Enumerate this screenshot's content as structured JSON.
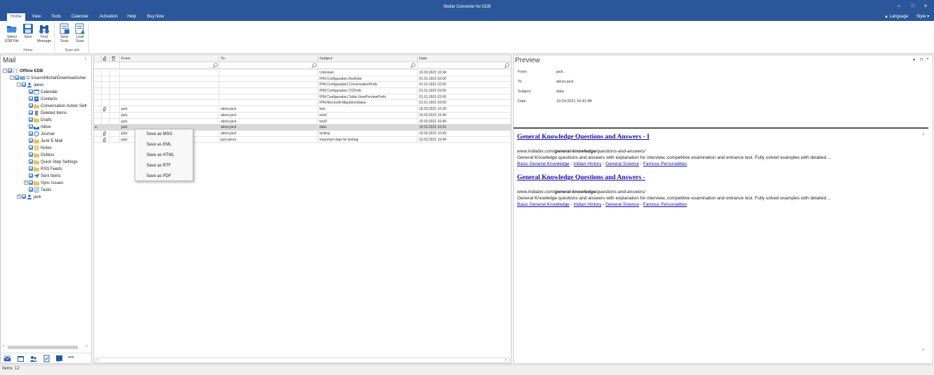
{
  "window": {
    "title": "Stellar Converter for EDB",
    "minimize": "–",
    "maximize": "□",
    "close": "×"
  },
  "ribbon_tabs": [
    "Home",
    "View",
    "Tools",
    "Calendar",
    "Activation",
    "Help",
    "Buy Now"
  ],
  "ribbon_right": {
    "language": "▲ Language",
    "style": "Style ▾"
  },
  "ribbon": {
    "home_group": {
      "label": "Home",
      "buttons": [
        {
          "label1": "Select",
          "label2": "EDB File"
        },
        {
          "label1": "Save",
          "label2": ""
        },
        {
          "label1": "Find",
          "label2": "Message"
        }
      ]
    },
    "scan_group": {
      "label": "Scan info",
      "buttons": [
        {
          "label1": "Save",
          "label2": "Scan"
        },
        {
          "label1": "Load",
          "label2": "Scan"
        }
      ]
    }
  },
  "left": {
    "title": "Mail",
    "collapse": "‹",
    "tree": [
      {
        "label": "Offline EDB",
        "level": 0,
        "exp": "−",
        "icon": "document-icon"
      },
      {
        "label": "C:\\Users\\Michal\\Downloads\\Ale",
        "level": 1,
        "exp": "−",
        "icon": "database-icon"
      },
      {
        "label": "alexo",
        "level": 2,
        "exp": "−",
        "icon": "user-icon"
      },
      {
        "label": "Calendar",
        "level": 3,
        "exp": "",
        "icon": "calendar-icon"
      },
      {
        "label": "Contacts",
        "level": 3,
        "exp": "",
        "icon": "contacts-icon"
      },
      {
        "label": "Conversation Action Sett",
        "level": 3,
        "exp": "",
        "icon": "folder-icon"
      },
      {
        "label": "Deleted Items",
        "level": 3,
        "exp": "",
        "icon": "trash-icon"
      },
      {
        "label": "Drafts",
        "level": 3,
        "exp": "",
        "icon": "folder-icon"
      },
      {
        "label": "Inbox",
        "level": 3,
        "exp": "",
        "icon": "inbox-icon"
      },
      {
        "label": "Journal",
        "level": 3,
        "exp": "",
        "icon": "journal-icon"
      },
      {
        "label": "Junk E-Mail",
        "level": 3,
        "exp": "",
        "icon": "folder-icon"
      },
      {
        "label": "Notes",
        "level": 3,
        "exp": "",
        "icon": "notes-icon"
      },
      {
        "label": "Outbox",
        "level": 3,
        "exp": "",
        "icon": "folder-icon"
      },
      {
        "label": "Quick Step Settings",
        "level": 3,
        "exp": "",
        "icon": "folder-icon"
      },
      {
        "label": "RSS Feeds",
        "level": 3,
        "exp": "",
        "icon": "folder-icon"
      },
      {
        "label": "Sent Items",
        "level": 3,
        "exp": "",
        "icon": "sent-icon"
      },
      {
        "label": "Sync Issues",
        "level": 3,
        "exp": "+",
        "icon": "folder-icon"
      },
      {
        "label": "Tasks",
        "level": 3,
        "exp": "",
        "icon": "tasks-icon"
      },
      {
        "label": "jack",
        "level": 2,
        "exp": "+",
        "icon": "user-icon"
      }
    ],
    "scroll_left": "‹",
    "scroll_right": "›",
    "more": "•••"
  },
  "grid": {
    "columns": [
      "From",
      "To",
      "Subject",
      "Date"
    ],
    "rows": [
      {
        "attach": "",
        "from": "",
        "to": "",
        "subject": "Unknown",
        "date": "19.03.2021 16:34",
        "selected": false
      },
      {
        "attach": "",
        "from": "",
        "to": "",
        "subject": "IPM.Configuration.RssRule",
        "date": "01.01.1601 02:00",
        "selected": false
      },
      {
        "attach": "",
        "from": "",
        "to": "",
        "subject": "IPM.Configuration.ConversationPrefs",
        "date": "01.01.1601 02:00",
        "selected": false
      },
      {
        "attach": "",
        "from": "",
        "to": "",
        "subject": "IPM.Configuration.TCPrefs",
        "date": "01.01.1601 02:00",
        "selected": false
      },
      {
        "attach": "",
        "from": "",
        "to": "",
        "subject": "IPM.Configuration.Table.ViewPreviewPrefs",
        "date": "01.01.1601 02:00",
        "selected": false
      },
      {
        "attach": "",
        "from": "",
        "to": "",
        "subject": "IPM.Microsoft.MigrationStatus",
        "date": "01.01.1601 02:00",
        "selected": false
      },
      {
        "attach": "📎",
        "from": "jack",
        "to": "alexo;jack",
        "subject": "test",
        "date": "19.03.2021 16:39",
        "selected": false
      },
      {
        "attach": "",
        "from": "jack",
        "to": "alexo;jack",
        "subject": "test1",
        "date": "19.03.2021 16:40",
        "selected": false
      },
      {
        "attach": "",
        "from": "jack",
        "to": "alexo;jack",
        "subject": "test2",
        "date": "19.03.2021 16:40",
        "selected": false
      },
      {
        "attach": "",
        "from": "jack",
        "to": "alexo;jack",
        "subject": "data",
        "date": "19.03.2021 16:41",
        "selected": true
      },
      {
        "attach": "📎",
        "from": "jack",
        "to": "alexo;jack",
        "subject": "testing",
        "date": "19.03.2021 16:43",
        "selected": false
      },
      {
        "attach": "📎",
        "from": "jack",
        "to": "jack;alexo",
        "subject": "important data for testing",
        "date": "19.03.2021 16:44",
        "selected": false
      }
    ]
  },
  "context_menu": [
    "Save as MSG",
    "Save as EML",
    "Save as HTML",
    "Save as RTF",
    "Save as PDF"
  ],
  "preview": {
    "title": "Preview",
    "controls": [
      "▾",
      "⊓",
      "×"
    ],
    "meta": [
      {
        "label": "From",
        "value": "jack"
      },
      {
        "label": "To",
        "value": "alexo;jack"
      },
      {
        "label": "Subject",
        "value": "data"
      },
      {
        "label": "Date",
        "value": "19.03.2021 16:41:48"
      }
    ],
    "results": [
      {
        "heading": "General Knowledge Questions and Answers - I",
        "url_pre": "www.indiabix.com/",
        "url_bold": "general-knowledge",
        "url_post": "/questions-and-answers/",
        "desc_em": "General Knowledge",
        "desc": " questions and answers with explanation for interview, competitive examination and entrance test. Fully solved examples with detailed ...",
        "links": [
          "Basic General Knowledge",
          "Indian History",
          "General Science",
          "Famous Personalities"
        ]
      },
      {
        "heading": "General Knowledge Questions and Answers -",
        "url_pre": "www.indiabix.com/",
        "url_bold": "general-knowledge",
        "url_post": "/questions-and-answers/",
        "desc_em": "General Knowledge",
        "desc": " questions and answers with explanation for interview, competitive examination and entrance test. Fully solved examples with detailed ...",
        "links": [
          "Basic General Knowledge",
          "Indian History",
          "General Science",
          "Famous Personalities"
        ]
      }
    ],
    "link_sep": " - "
  },
  "status": {
    "text": "Items: 12"
  },
  "colors": {
    "titlebar": "#2b579a",
    "link": "#1a0dab",
    "selected_row": "#d9d9d9"
  }
}
